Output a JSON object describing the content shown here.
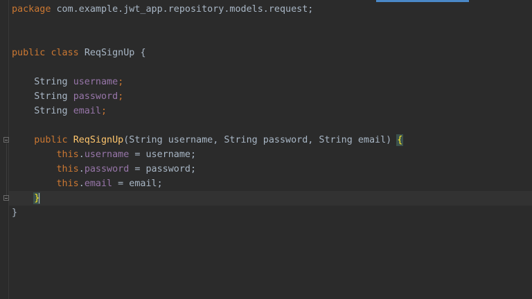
{
  "editor": {
    "lines": {
      "l1": {
        "kw": "package",
        "rest": " com.example.jwt_app.repository.models.request;"
      },
      "l4": {
        "kw1": "public",
        "kw2": "class",
        "name": "ReqSignUp",
        "brace": "{"
      },
      "l6": {
        "type": "String",
        "field": "username",
        "semi": ";"
      },
      "l7": {
        "type": "String",
        "field": "password",
        "semi": ";"
      },
      "l8": {
        "type": "String",
        "field": "email",
        "semi": ";"
      },
      "l10": {
        "kw": "public",
        "method": "ReqSignUp",
        "params": "(String username, String password, String email) ",
        "brace": "{"
      },
      "l11": {
        "kw": "this",
        "field": "username",
        "rest": " = username;"
      },
      "l12": {
        "kw": "this",
        "field": "password",
        "rest": " = password;"
      },
      "l13": {
        "kw": "this",
        "field": "email",
        "rest": " = email;"
      },
      "l14": {
        "brace": "}"
      },
      "l15": {
        "brace": "}"
      }
    }
  }
}
